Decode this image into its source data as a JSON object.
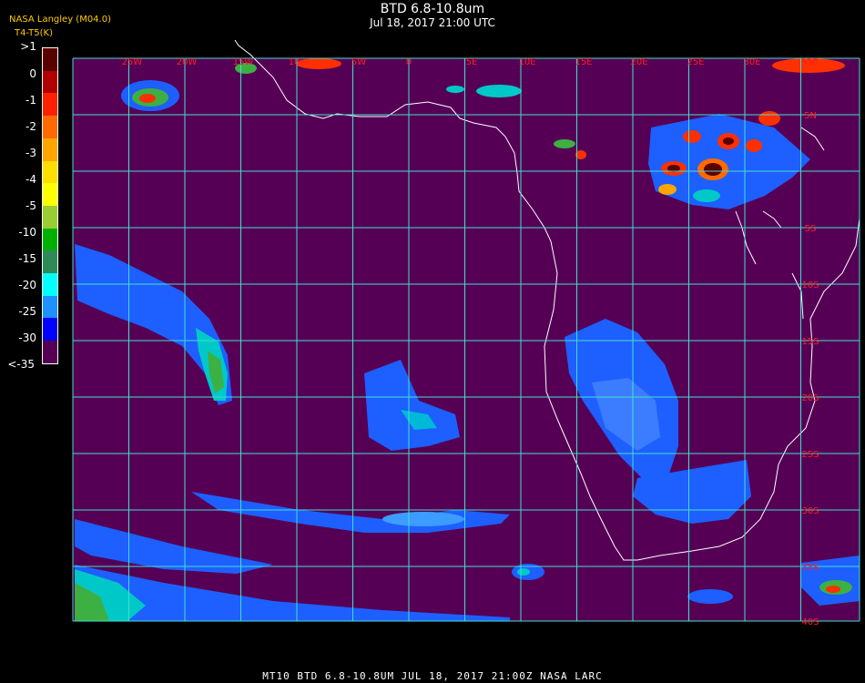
{
  "header": {
    "title": "BTD 6.8-10.8um",
    "subtitle": "Jul 18, 2017 21:00 UTC",
    "credit_line1": "NASA Langley (M04.0)",
    "credit_line2": "T4-T5(K)"
  },
  "colorbar": {
    "labels": [
      ">1",
      "0",
      "-1",
      "-2",
      "-3",
      "-4",
      "-5",
      "-10",
      "-15",
      "-20",
      "-25",
      "-30",
      "<-35"
    ],
    "colors": [
      "#5a0000",
      "#b00000",
      "#ff2000",
      "#ff6a00",
      "#ffa500",
      "#ffdd00",
      "#ffff00",
      "#9acd32",
      "#00b000",
      "#2e8b57",
      "#00ffff",
      "#1e90ff",
      "#0000ff",
      "#550055"
    ]
  },
  "map": {
    "background_color": "#550055",
    "grid_color": "#40e0d0",
    "coast_color": "#ffffff",
    "label_color": "#ff2020",
    "lon_labels": [
      "25W",
      "20W",
      "15W",
      "10W",
      "5W",
      "0",
      "5E",
      "10E",
      "15E",
      "20E",
      "25E",
      "30E",
      "35E"
    ],
    "lat_labels": [
      "5N",
      "5S",
      "10S",
      "15S",
      "20S",
      "25S",
      "30S",
      "35S",
      "40S"
    ]
  },
  "footer": {
    "text": "MT10   BTD 6.8-10.8UM    JUL 18, 2017 21:00Z    NASA LARC"
  }
}
